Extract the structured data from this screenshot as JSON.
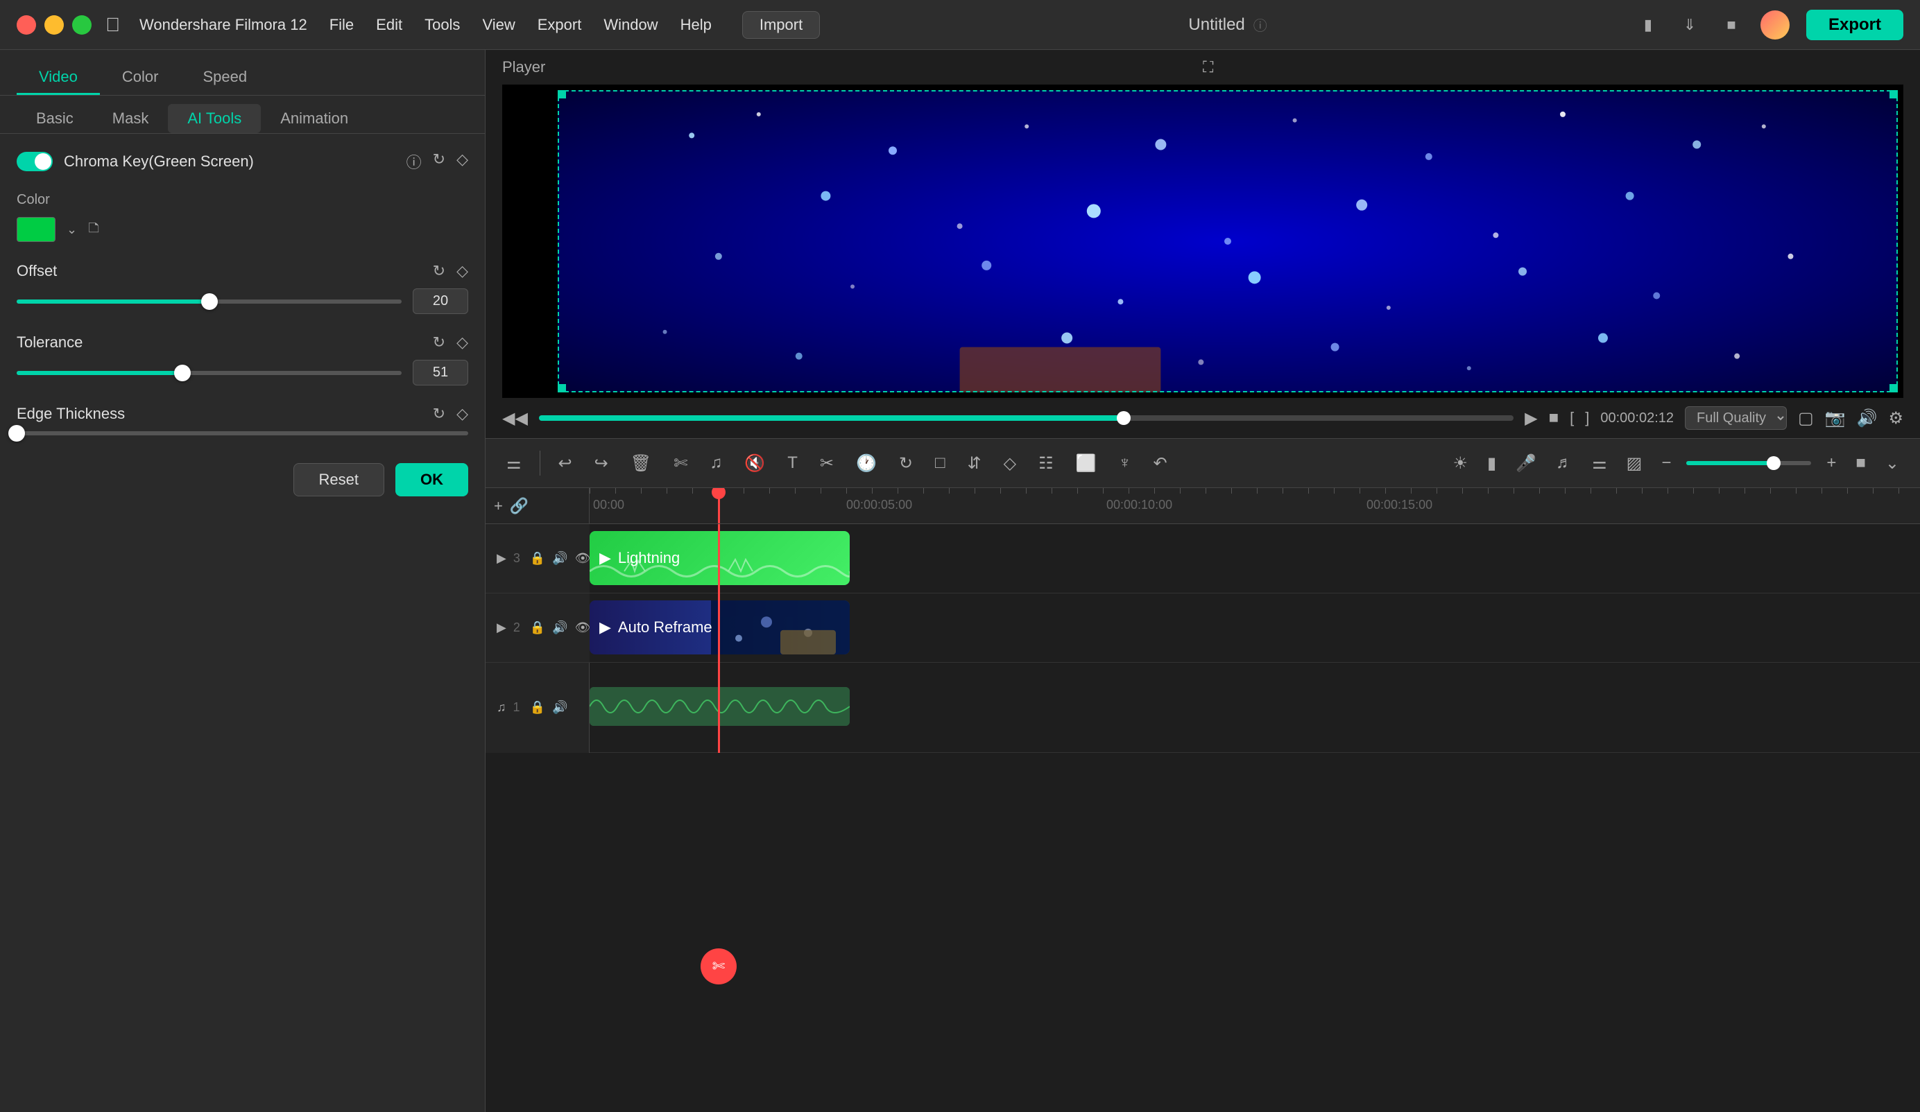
{
  "app": {
    "name": "Wondershare Filmora 12",
    "title": "Untitled",
    "menus": [
      "File",
      "Edit",
      "Tools",
      "View",
      "Export",
      "Window",
      "Help"
    ]
  },
  "titlebar": {
    "import_label": "Import",
    "export_label": "Export",
    "title": "Untitled"
  },
  "left_panel": {
    "tabs": [
      "Video",
      "Color",
      "Speed"
    ],
    "active_tab": "Video",
    "sub_tabs": [
      "Basic",
      "Mask",
      "AI Tools",
      "Animation"
    ],
    "active_sub_tab": "AI Tools",
    "chroma_key": {
      "label": "Chroma Key(Green Screen)",
      "enabled": true
    },
    "color_label": "Color",
    "offset": {
      "label": "Offset",
      "value": "20",
      "percent": 50
    },
    "tolerance": {
      "label": "Tolerance",
      "value": "51",
      "percent": 43
    },
    "edge_thickness": {
      "label": "Edge Thickness"
    },
    "reset_label": "Reset",
    "ok_label": "OK"
  },
  "player": {
    "label": "Player",
    "time": "00:00:02:12",
    "quality": "Full Quality",
    "bracket_left": "[",
    "bracket_right": "]"
  },
  "toolbar": {
    "icons": [
      "grid",
      "undo",
      "redo",
      "trash",
      "scissors",
      "music",
      "mute",
      "text",
      "crop-t",
      "clock",
      "loop",
      "crop-r",
      "expand",
      "diamond",
      "sliders",
      "square",
      "wave",
      "reset"
    ],
    "right_icons": [
      "sun",
      "shield",
      "mic",
      "music",
      "grid",
      "monitor",
      "minus",
      "plus",
      "grid"
    ]
  },
  "timeline": {
    "time_marks": [
      "00:00",
      "00:00:05:00",
      "00:00:10:00",
      "00:00:15:00"
    ],
    "tracks": [
      {
        "num": "3",
        "type": "video",
        "clips": [
          {
            "name": "Lightning",
            "color": "green"
          }
        ]
      },
      {
        "num": "2",
        "type": "video",
        "clips": [
          {
            "name": "Auto Reframe",
            "color": "blue"
          }
        ]
      },
      {
        "num": "1",
        "type": "audio"
      }
    ]
  }
}
